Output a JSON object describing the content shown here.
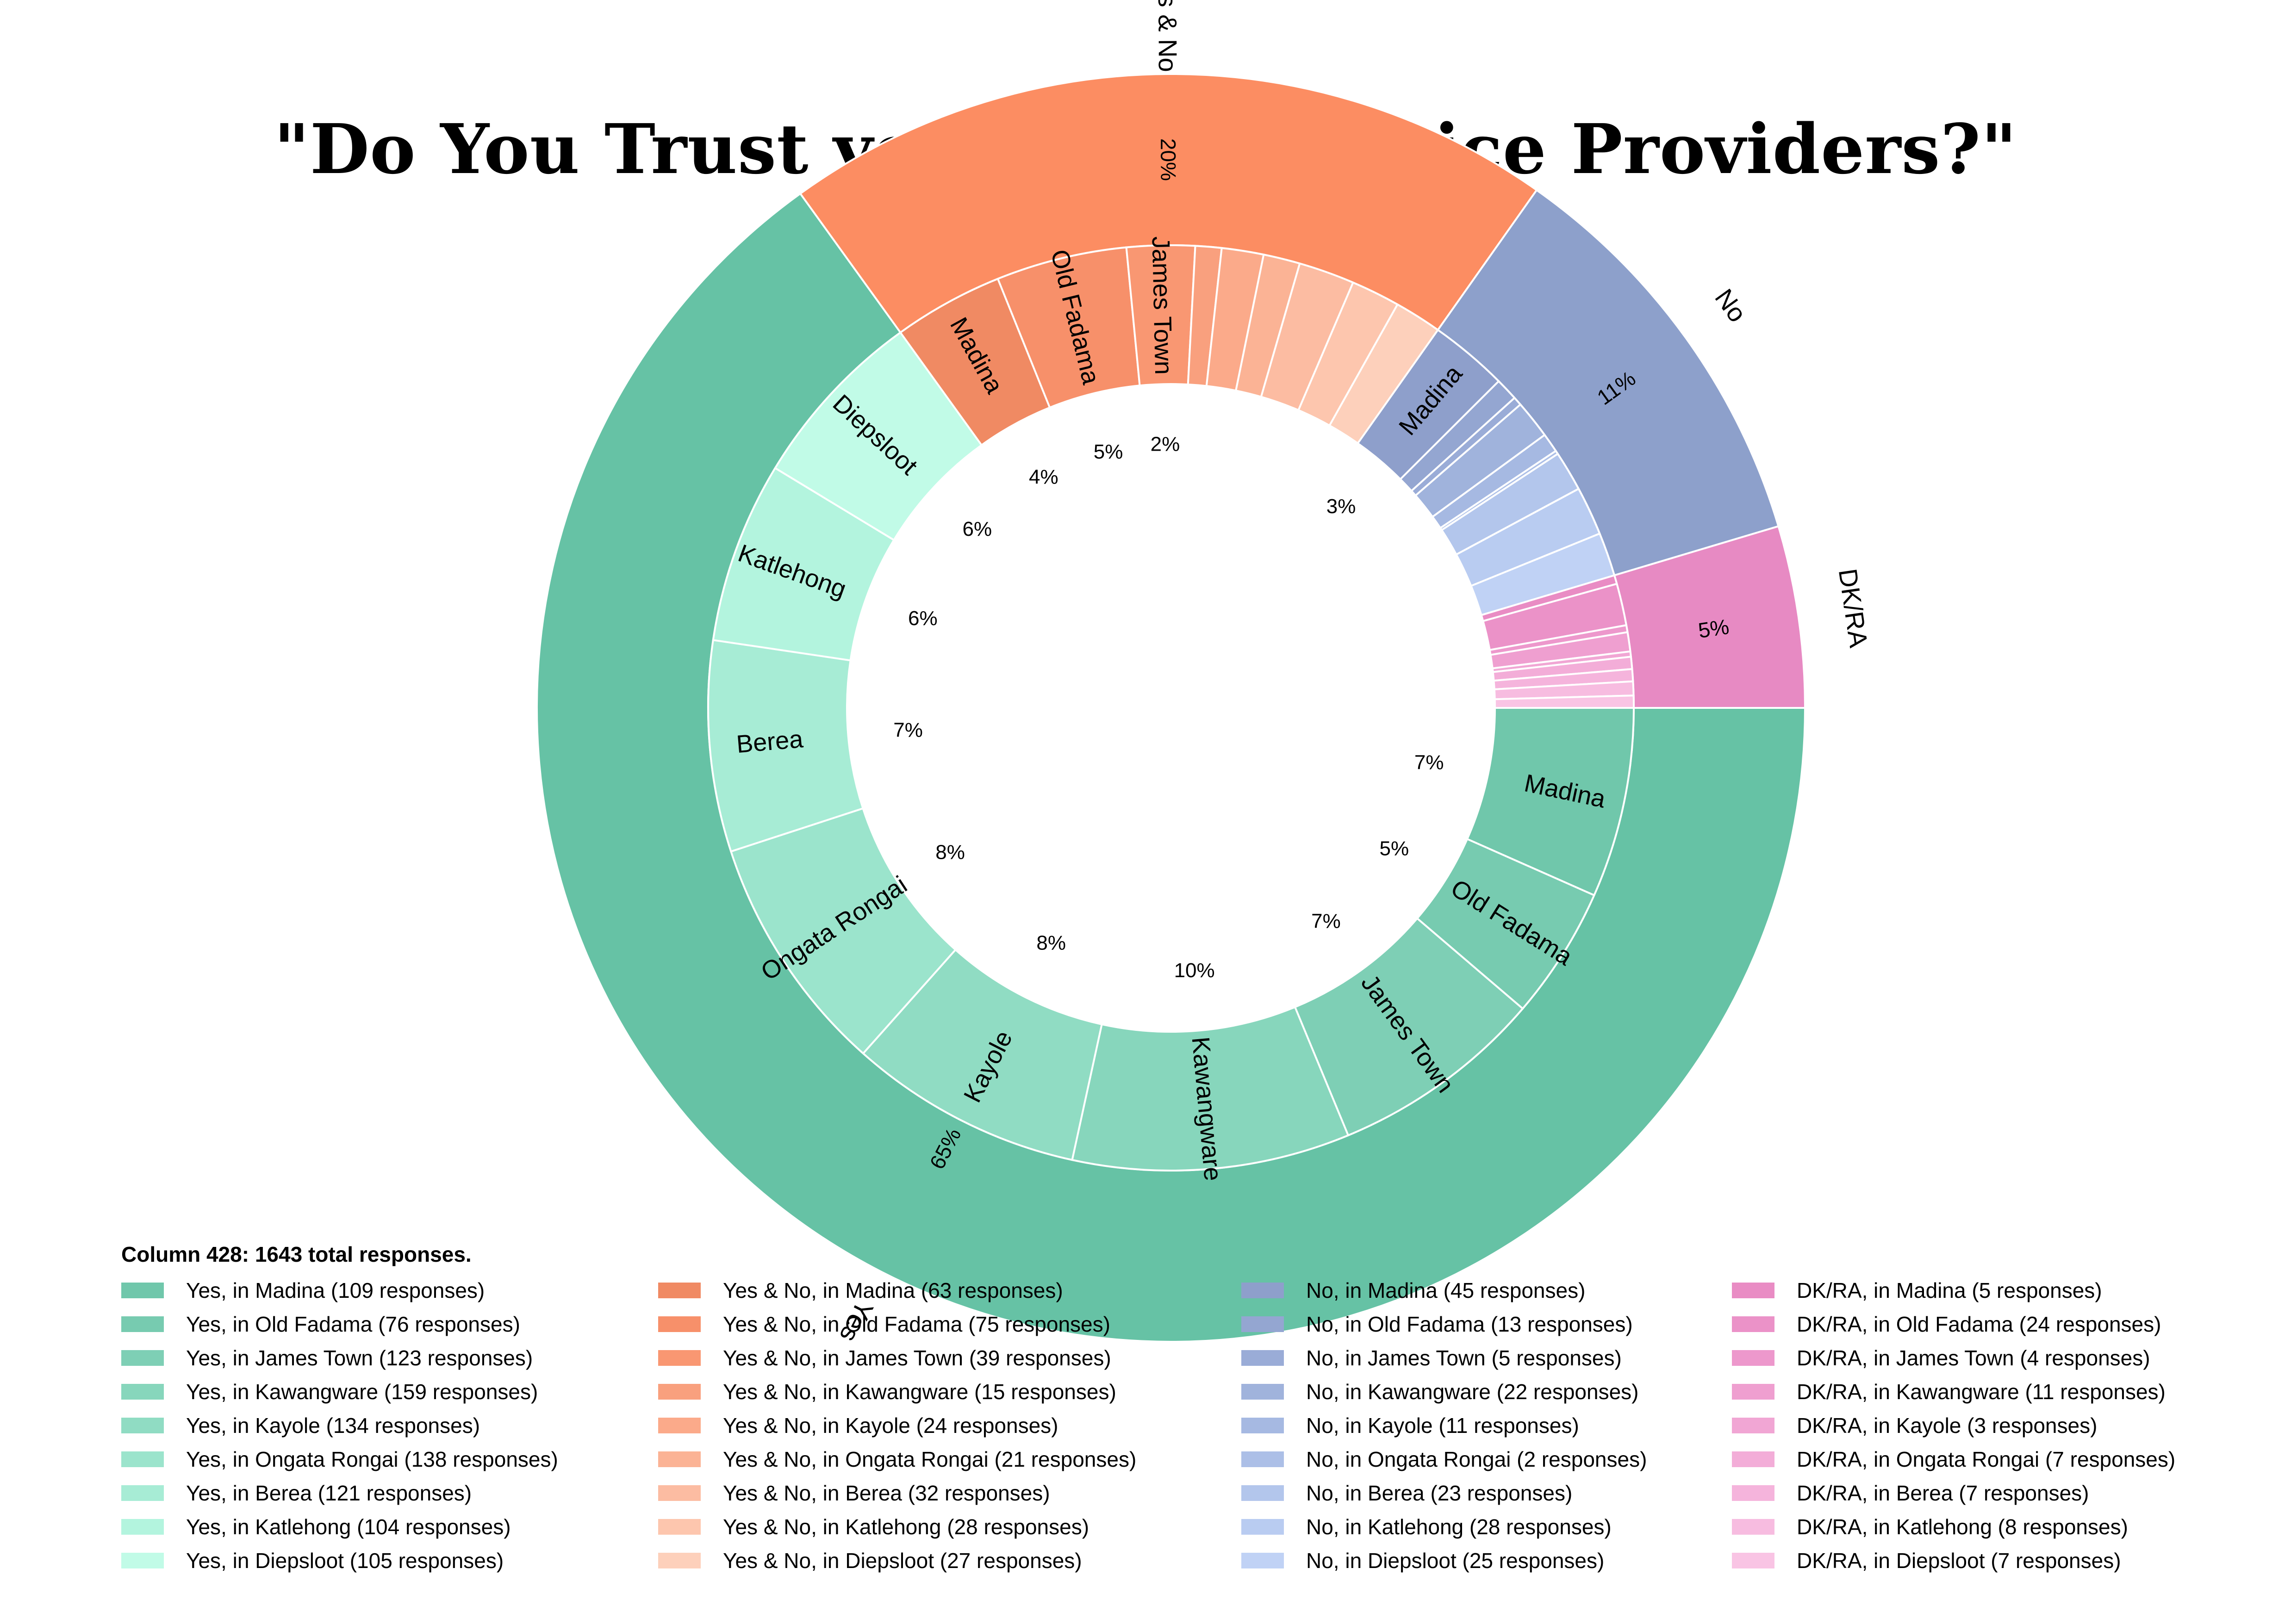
{
  "title": "\"Do You Trust your Local Service Providers?\"",
  "chart_data": {
    "type": "sunburst",
    "total_caption": "Column 428: 1643 total responses.",
    "total": 1643,
    "inner_percent_labels": [
      "7%",
      "5%",
      "7%",
      "10%",
      "8%",
      "8%",
      "7%",
      "6%",
      "6%",
      "4%",
      "5%",
      "2%",
      "3%"
    ],
    "groups": [
      {
        "name": "Yes",
        "percent_label": "65%",
        "color": "#66c2a5",
        "children": [
          {
            "location": "Madina",
            "value": 109,
            "color": "#70c7ab",
            "show_label": true
          },
          {
            "location": "Old Fadama",
            "value": 76,
            "color": "#77cbb0",
            "show_label": true
          },
          {
            "location": "James Town",
            "value": 123,
            "color": "#7ecfb5",
            "show_label": true
          },
          {
            "location": "Kawangware",
            "value": 159,
            "color": "#87d6bc",
            "show_label": true
          },
          {
            "location": "Kayole",
            "value": 134,
            "color": "#90dcc3",
            "show_label": true
          },
          {
            "location": "Ongata Rongai",
            "value": 138,
            "color": "#9be4cc",
            "show_label": true
          },
          {
            "location": "Berea",
            "value": 121,
            "color": "#a7ecd5",
            "show_label": true
          },
          {
            "location": "Katlehong",
            "value": 104,
            "color": "#b3f4de",
            "show_label": true
          },
          {
            "location": "Diepsloot",
            "value": 105,
            "color": "#c1fbe7",
            "show_label": true
          }
        ]
      },
      {
        "name": "Yes & No",
        "percent_label": "20%",
        "color": "#fc8d62",
        "children": [
          {
            "location": "Madina",
            "value": 63,
            "color": "#f08a63",
            "show_label": true
          },
          {
            "location": "Old Fadama",
            "value": 75,
            "color": "#f7906a",
            "show_label": true
          },
          {
            "location": "James Town",
            "value": 39,
            "color": "#f99772",
            "show_label": true
          },
          {
            "location": "Kawangware",
            "value": 15,
            "color": "#f9a07e",
            "show_label": false
          },
          {
            "location": "Kayole",
            "value": 24,
            "color": "#fbaa8a",
            "show_label": false
          },
          {
            "location": "Ongata Rongai",
            "value": 21,
            "color": "#fbb395",
            "show_label": false
          },
          {
            "location": "Berea",
            "value": 32,
            "color": "#fcbca2",
            "show_label": false
          },
          {
            "location": "Katlehong",
            "value": 28,
            "color": "#fdc6ae",
            "show_label": false
          },
          {
            "location": "Diepsloot",
            "value": 27,
            "color": "#fdd0bb",
            "show_label": false
          }
        ]
      },
      {
        "name": "No",
        "percent_label": "11%",
        "color": "#8da0cb",
        "children": [
          {
            "location": "Madina",
            "value": 45,
            "color": "#8e9fcb",
            "show_label": true
          },
          {
            "location": "Old Fadama",
            "value": 13,
            "color": "#94a6d1",
            "show_label": false
          },
          {
            "location": "James Town",
            "value": 5,
            "color": "#9aacd7",
            "show_label": false
          },
          {
            "location": "Kawangware",
            "value": 22,
            "color": "#a0b3dc",
            "show_label": false
          },
          {
            "location": "Kayole",
            "value": 11,
            "color": "#a6b9e2",
            "show_label": false
          },
          {
            "location": "Ongata Rongai",
            "value": 2,
            "color": "#acbfe7",
            "show_label": false
          },
          {
            "location": "Berea",
            "value": 23,
            "color": "#b3c6ec",
            "show_label": false
          },
          {
            "location": "Katlehong",
            "value": 28,
            "color": "#b9ccf1",
            "show_label": false
          },
          {
            "location": "Diepsloot",
            "value": 25,
            "color": "#c0d2f5",
            "show_label": false
          }
        ]
      },
      {
        "name": "DK/RA",
        "percent_label": "5%",
        "color": "#e78ac3",
        "children": [
          {
            "location": "Madina",
            "value": 5,
            "color": "#e98cc4",
            "show_label": false
          },
          {
            "location": "Old Fadama",
            "value": 24,
            "color": "#eb92c8",
            "show_label": false
          },
          {
            "location": "James Town",
            "value": 4,
            "color": "#ed98cc",
            "show_label": false
          },
          {
            "location": "Kawangware",
            "value": 11,
            "color": "#ef9fd0",
            "show_label": false
          },
          {
            "location": "Kayole",
            "value": 3,
            "color": "#f1a6d4",
            "show_label": false
          },
          {
            "location": "Ongata Rongai",
            "value": 7,
            "color": "#f3add8",
            "show_label": false
          },
          {
            "location": "Berea",
            "value": 7,
            "color": "#f5b4dc",
            "show_label": false
          },
          {
            "location": "Katlehong",
            "value": 8,
            "color": "#f7bce0",
            "show_label": false
          },
          {
            "location": "Diepsloot",
            "value": 7,
            "color": "#f9c4e4",
            "show_label": false
          }
        ]
      }
    ]
  },
  "legend": {
    "title": "Column 428: 1643 total responses.",
    "columns": [
      [
        "Yes, in Madina (109 responses)",
        "Yes, in Old Fadama (76 responses)",
        "Yes, in James Town (123 responses)",
        "Yes, in Kawangware (159 responses)",
        "Yes, in Kayole (134 responses)",
        "Yes, in Ongata Rongai (138 responses)",
        "Yes, in Berea (121 responses)",
        "Yes, in Katlehong (104 responses)",
        "Yes, in Diepsloot (105 responses)"
      ],
      [
        "Yes & No, in Madina (63 responses)",
        "Yes & No, in Old Fadama (75 responses)",
        "Yes & No, in James Town (39 responses)",
        "Yes & No, in Kawangware (15 responses)",
        "Yes & No, in Kayole (24 responses)",
        "Yes & No, in Ongata Rongai (21 responses)",
        "Yes & No, in Berea (32 responses)",
        "Yes & No, in Katlehong (28 responses)",
        "Yes & No, in Diepsloot (27 responses)"
      ],
      [
        "No, in Madina (45 responses)",
        "No, in Old Fadama (13 responses)",
        "No, in James Town (5 responses)",
        "No, in Kawangware (22 responses)",
        "No, in Kayole (11 responses)",
        "No, in Ongata Rongai (2 responses)",
        "No, in Berea (23 responses)",
        "No, in Katlehong (28 responses)",
        "No, in Diepsloot (25 responses)"
      ],
      [
        "DK/RA, in Madina (5 responses)",
        "DK/RA, in Old Fadama (24 responses)",
        "DK/RA, in James Town (4 responses)",
        "DK/RA, in Kawangware (11 responses)",
        "DK/RA, in Kayole (3 responses)",
        "DK/RA, in Ongata Rongai (7 responses)",
        "DK/RA, in Berea (7 responses)",
        "DK/RA, in Katlehong (8 responses)",
        "DK/RA, in Diepsloot (7 responses)"
      ]
    ]
  }
}
